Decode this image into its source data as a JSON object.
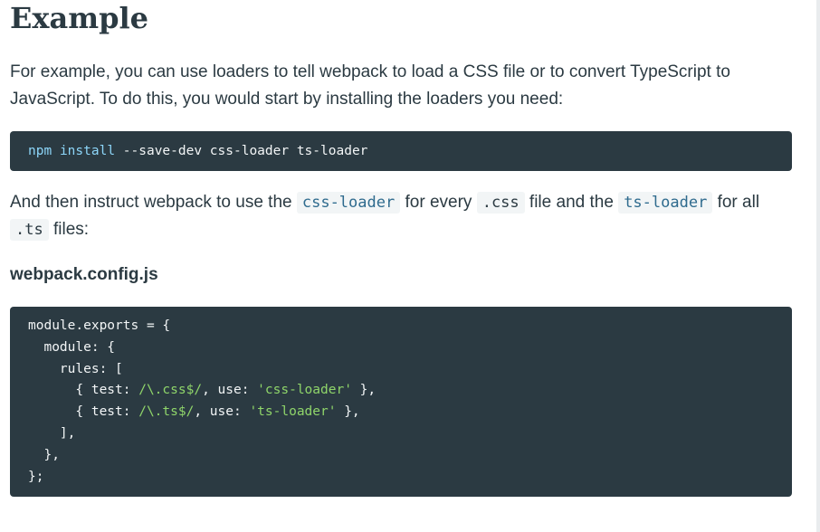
{
  "heading": "Example",
  "intro": {
    "line1": "For example, you can use loaders to tell webpack to load a CSS file or to convert TypeScript to",
    "line2": "JavaScript. To do this, you would start by installing the loaders you need:"
  },
  "install_command": {
    "npm": "npm",
    "install": "install",
    "rest": " --save-dev css-loader ts-loader"
  },
  "instruction": {
    "part1": "And then instruct webpack to use the ",
    "code1": "css-loader",
    "part2": " for every ",
    "code2": ".css",
    "part3": " file and the ",
    "code3": "ts-loader",
    "part4": " for all",
    "code4": ".ts",
    "part5": " files:"
  },
  "file_label": "webpack.config.js",
  "config": {
    "l1_a": "module",
    "l1_b": ".exports = {",
    "l2": "  module: {",
    "l3": "    rules: [",
    "l4_a": "      { test: ",
    "l4_b": "/\\.css$/",
    "l4_c": ", use: ",
    "l4_d": "'css-loader'",
    "l4_e": " },",
    "l5_a": "      { test: ",
    "l5_b": "/\\.ts$/",
    "l5_c": ", use: ",
    "l5_d": "'ts-loader'",
    "l5_e": " },",
    "l6": "    ],",
    "l7": "  },",
    "l8": "};"
  },
  "colors": {
    "text": "#2b3a42",
    "code_bg": "#2b3a42",
    "code_keyword": "#8dd6f9",
    "code_string": "#8fd56a",
    "inline_code_bg": "#f2f5f6",
    "inline_code_text": "#2f6b8e"
  }
}
